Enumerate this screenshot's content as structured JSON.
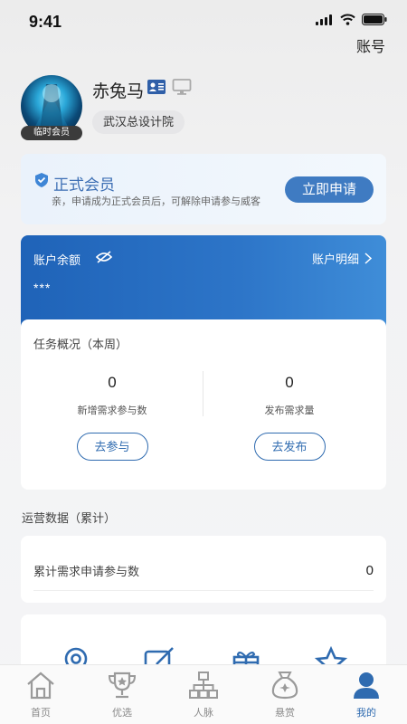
{
  "status_bar": {
    "time": "9:41"
  },
  "header": {
    "account_label": "账号"
  },
  "profile": {
    "name": "赤兔马",
    "avatar_badge": "临时会员",
    "organization": "武汉总设计院"
  },
  "member_card": {
    "title": "正式会员",
    "description": "亲，申请成为正式会员后，可解除申请参与威客",
    "apply_label": "立即申请"
  },
  "balance": {
    "label": "账户余额",
    "detail_label": "账户明细",
    "value": "***"
  },
  "tasks": {
    "title": "任务概况（本周）",
    "items": [
      {
        "count": "0",
        "label": "新增需求参与数",
        "button": "去参与"
      },
      {
        "count": "0",
        "label": "发布需求量",
        "button": "去发布"
      }
    ]
  },
  "ops": {
    "title": "运营数据（累计）",
    "label": "累计需求申请参与数",
    "value": "0"
  },
  "tabs": [
    {
      "label": "首页",
      "icon": "home-icon"
    },
    {
      "label": "优选",
      "icon": "trophy-icon"
    },
    {
      "label": "人脉",
      "icon": "network-icon"
    },
    {
      "label": "悬赏",
      "icon": "reward-bag-icon"
    },
    {
      "label": "我的",
      "icon": "user-icon",
      "active": true
    }
  ],
  "colors": {
    "accent": "#2f6bb0",
    "card_blue": "#1f63b8"
  }
}
